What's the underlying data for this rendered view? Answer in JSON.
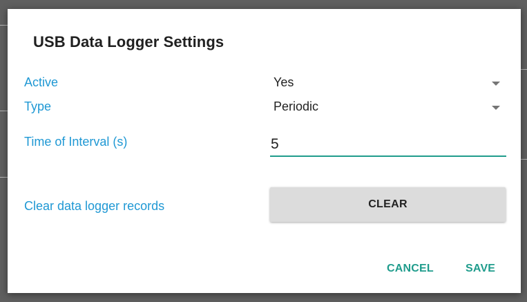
{
  "dialog": {
    "title": "USB Data Logger Settings"
  },
  "fields": {
    "active": {
      "label": "Active",
      "value": "Yes"
    },
    "type": {
      "label": "Type",
      "value": "Periodic"
    },
    "interval": {
      "label": "Time of Interval (s)",
      "value": "5"
    },
    "clear_records": {
      "label": "Clear data logger records",
      "button_label": "CLEAR"
    }
  },
  "actions": {
    "cancel_label": "CANCEL",
    "save_label": "SAVE"
  },
  "colors": {
    "label_blue": "#1f98d4",
    "accent_teal": "#1f9c8c",
    "button_gray": "#dcdcdc"
  },
  "icons": {
    "dropdown": "chevron-down-icon"
  }
}
